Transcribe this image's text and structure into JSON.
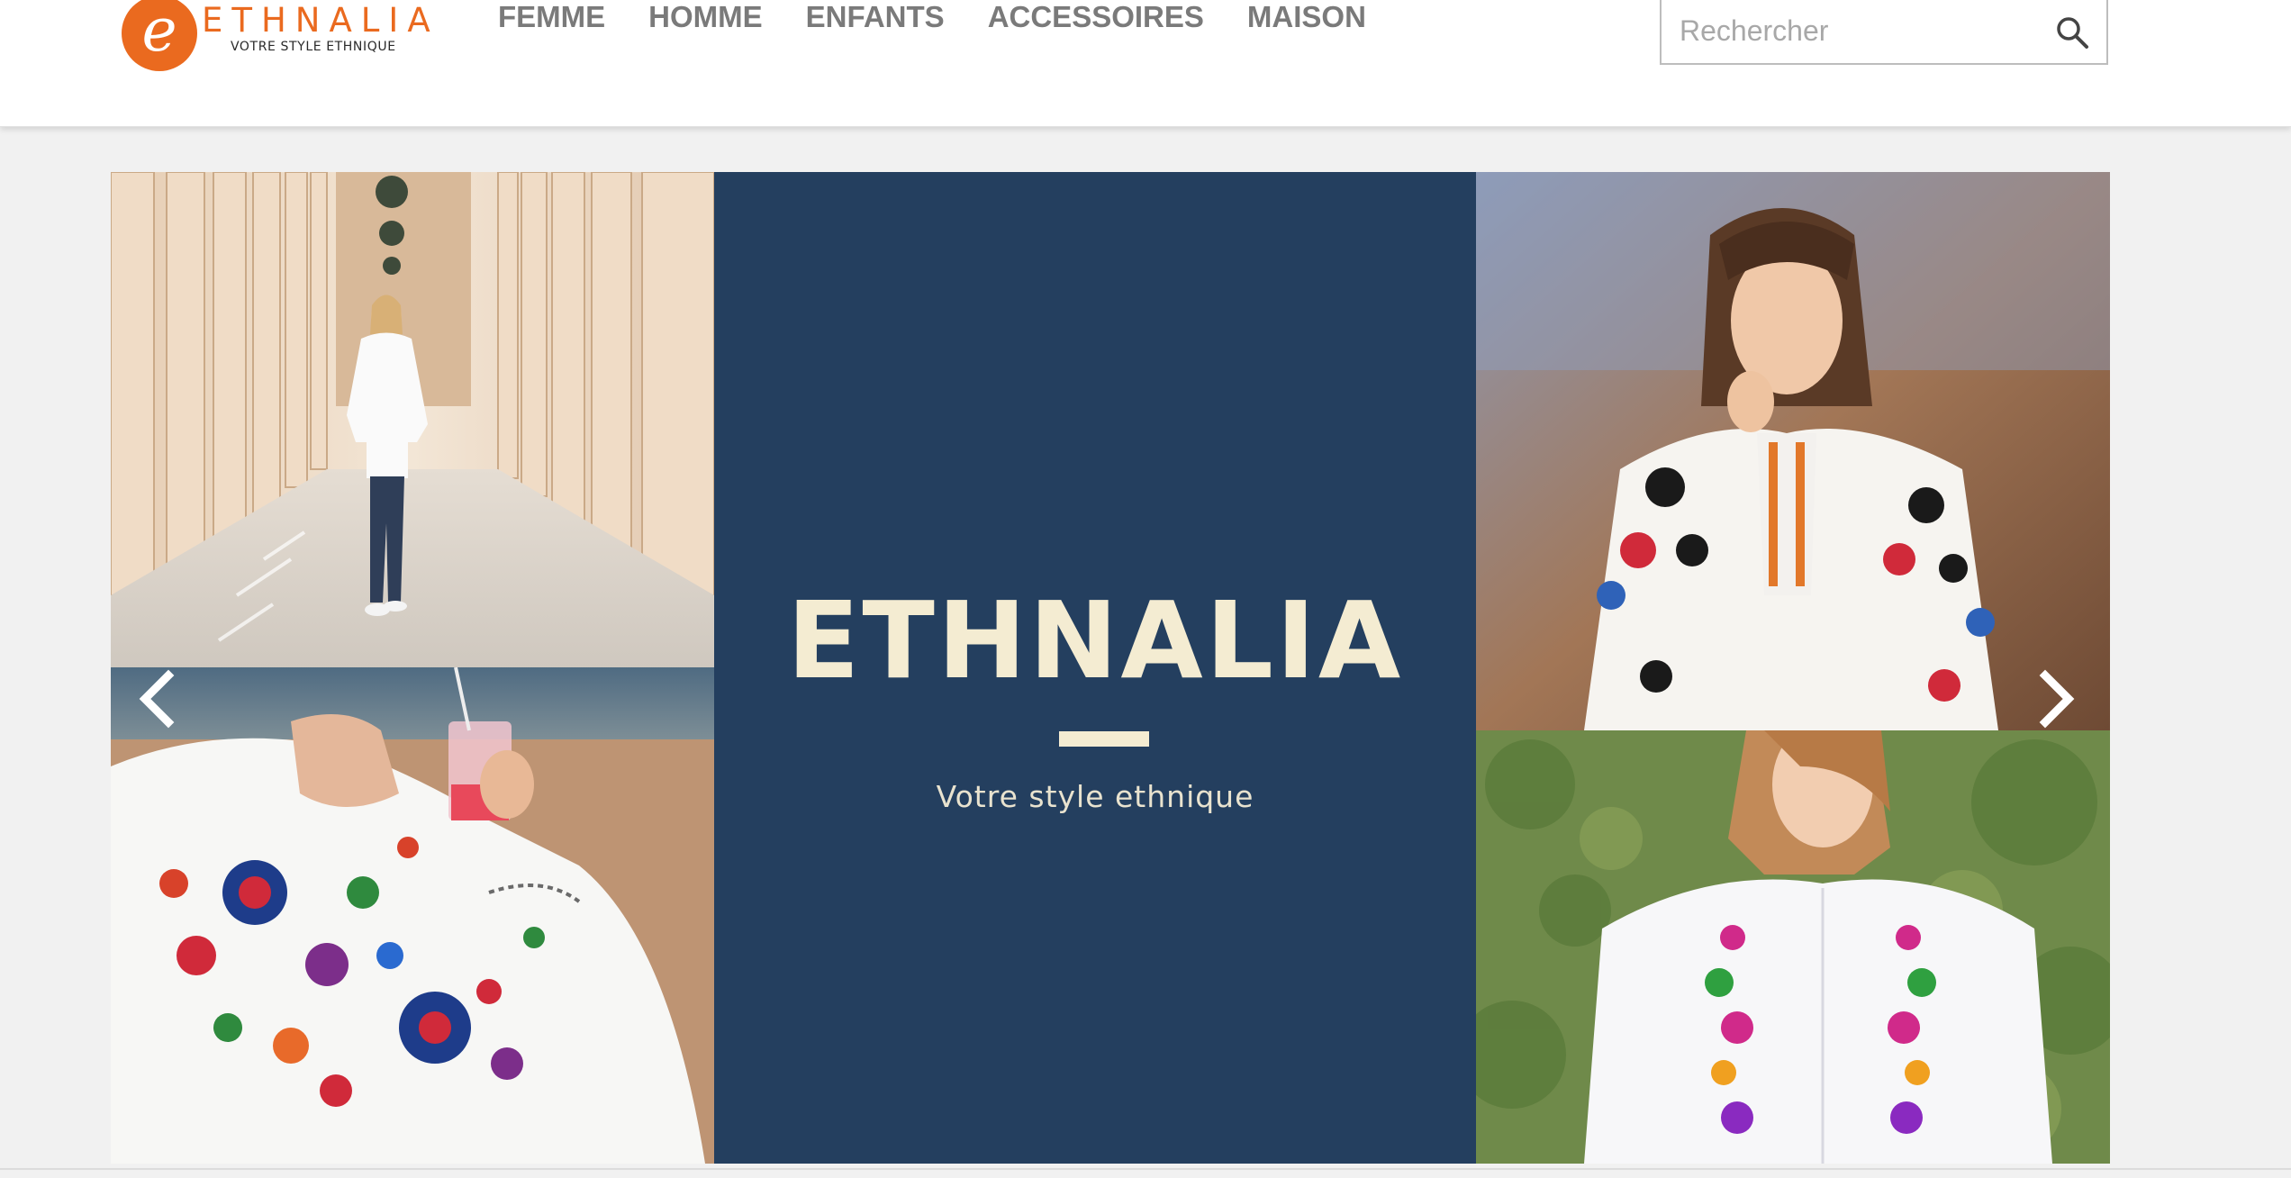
{
  "brand": {
    "name": "ETHNALIA",
    "logo_letter": "e",
    "tagline": "VOTRE STYLE ETHNIQUE",
    "accent_color": "#ea6a1f"
  },
  "nav": {
    "items": [
      {
        "label": "FEMME"
      },
      {
        "label": "HOMME"
      },
      {
        "label": "ENFANTS"
      },
      {
        "label": "ACCESSOIRES"
      },
      {
        "label": "MAISON"
      }
    ]
  },
  "search": {
    "placeholder": "Rechercher",
    "value": "",
    "icon": "search-icon"
  },
  "hero": {
    "title": "ETHNALIA",
    "subtitle": "Votre style ethnique",
    "panel_color": "#243f5f",
    "text_color": "#f4ecd2",
    "prev_icon": "chevron-left-icon",
    "next_icon": "chevron-right-icon",
    "photos": [
      {
        "name": "photo-colonnade-woman"
      },
      {
        "name": "photo-beach-drink"
      },
      {
        "name": "photo-girl-embroidered-blouse"
      },
      {
        "name": "photo-woman-floral-shirt"
      }
    ]
  }
}
